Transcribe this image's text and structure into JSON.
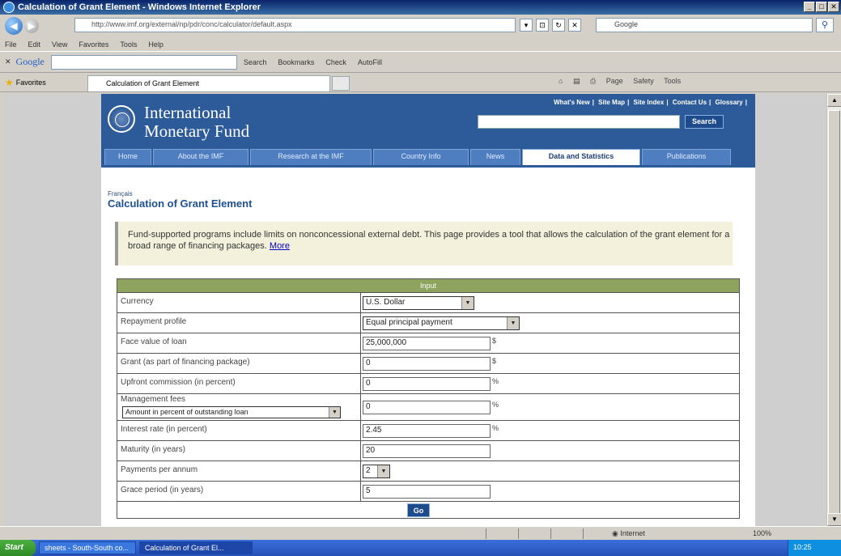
{
  "window": {
    "title": "Calculation of Grant Element - Windows Internet Explorer"
  },
  "browser": {
    "address": "http://www.imf.org/external/np/pdr/conc/calculator/default.aspx",
    "menu": [
      "File",
      "Edit",
      "View",
      "Favorites",
      "Tools",
      "Help"
    ],
    "google_label": "Google",
    "google_tools": [
      "Search",
      "Bookmarks",
      "Check",
      "AutoFill"
    ],
    "favorites_label": "Favorites",
    "tab_title": "Calculation of Grant Element",
    "command_bar": [
      "Page",
      "Safety",
      "Tools"
    ],
    "search_engine": "Google",
    "status_zone": "Internet",
    "zoom": "100%"
  },
  "imf": {
    "name_line1": "International",
    "name_line2": "Monetary Fund",
    "top_links": [
      "What's New",
      "Site Map",
      "Site Index",
      "Contact Us",
      "Glossary"
    ],
    "search_button": "Search",
    "nav": [
      "Home",
      "About the IMF",
      "Research at the IMF",
      "Country Info",
      "News",
      "Data and Statistics",
      "Publications"
    ],
    "active_nav": "Data and Statistics"
  },
  "content": {
    "breadcrumb": "Français",
    "title": "Calculation of Grant Element",
    "intro": "Fund-supported programs include limits on nonconcessional external debt. This page provides a tool that allows the calculation of the grant element for a broad range of financing packages.",
    "more_link": "More"
  },
  "form": {
    "header": "Input",
    "rows": [
      {
        "label": "Currency",
        "value": "U.S. Dollar",
        "unit": ""
      },
      {
        "label": "Repayment profile",
        "value": "Equal principal payment",
        "unit": ""
      },
      {
        "label": "Face value of loan",
        "value": "25,000,000",
        "unit": "$"
      },
      {
        "label": "Grant (as part of financing package)",
        "value": "0",
        "unit": "$"
      },
      {
        "label": "Upfront commission (in percent)",
        "value": "0",
        "unit": "%"
      },
      {
        "label": "Management fees",
        "value": "0",
        "unit": "%",
        "option": "Amount in percent of outstanding loan"
      },
      {
        "label": "Interest rate (in percent)",
        "value": "2.45",
        "unit": "%"
      },
      {
        "label": "Maturity (in years)",
        "value": "20",
        "unit": ""
      },
      {
        "label": "Payments per annum",
        "value": "2",
        "unit": ""
      },
      {
        "label": "Grace period (in years)",
        "value": "5",
        "unit": ""
      }
    ],
    "go_button": "Go"
  },
  "taskbar": {
    "start": "Start",
    "items": [
      "sheets - South-South co...",
      "Calculation of Grant El..."
    ],
    "clock": "10:25"
  }
}
